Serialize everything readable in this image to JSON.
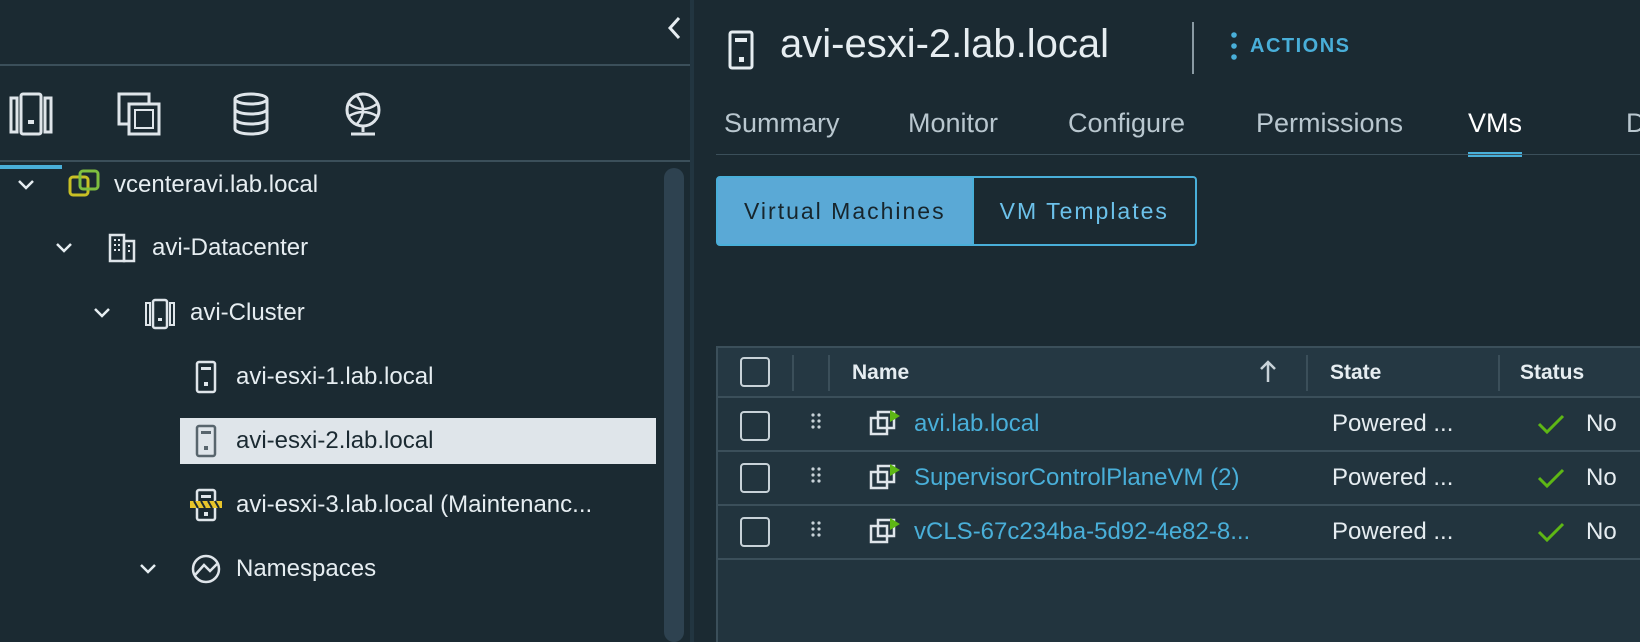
{
  "navigator": {
    "tree": [
      {
        "label": "vcenteravi.lab.local",
        "icon": "vcenter-icon"
      },
      {
        "label": "avi-Datacenter",
        "icon": "datacenter-icon"
      },
      {
        "label": "avi-Cluster",
        "icon": "cluster-icon"
      },
      {
        "label": "avi-esxi-1.lab.local",
        "icon": "host-icon"
      },
      {
        "label": "avi-esxi-2.lab.local",
        "icon": "host-icon",
        "selected": true
      },
      {
        "label": "avi-esxi-3.lab.local (Maintenanc...",
        "icon": "host-maintenance-icon"
      },
      {
        "label": "Namespaces",
        "icon": "namespaces-icon"
      }
    ]
  },
  "header": {
    "title": "avi-esxi-2.lab.local",
    "actions_label": "ACTIONS"
  },
  "tabs": [
    {
      "label": "Summary"
    },
    {
      "label": "Monitor"
    },
    {
      "label": "Configure"
    },
    {
      "label": "Permissions"
    },
    {
      "label": "VMs",
      "active": true
    },
    {
      "label": "D"
    }
  ],
  "segments": {
    "virtual_machines": "Virtual Machines",
    "vm_templates": "VM Templates"
  },
  "grid": {
    "columns": {
      "name": "Name",
      "state": "State",
      "status": "Status"
    },
    "rows": [
      {
        "name": "avi.lab.local",
        "state": "Powered ...",
        "status": "No"
      },
      {
        "name": "SupervisorControlPlaneVM (2)",
        "state": "Powered ...",
        "status": "No"
      },
      {
        "name": "vCLS-67c234ba-5d92-4e82-8...",
        "state": "Powered ...",
        "status": "No"
      }
    ]
  },
  "colors": {
    "accent": "#49afd9",
    "background": "#1b2a32",
    "ok_green": "#5eb715"
  }
}
